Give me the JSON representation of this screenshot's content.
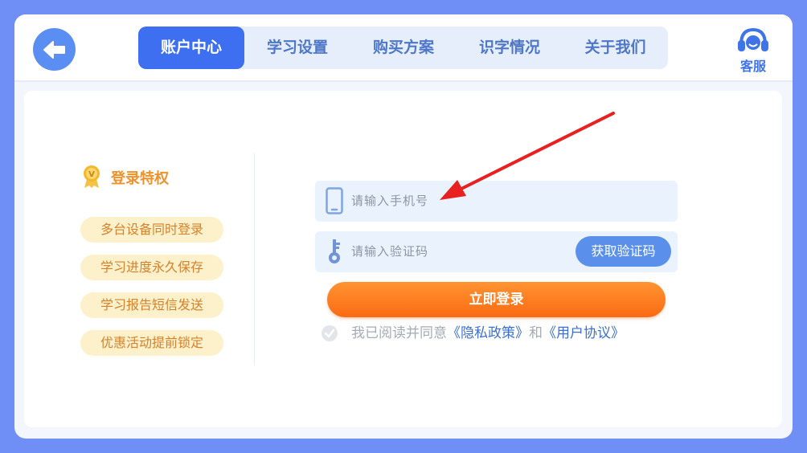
{
  "header": {
    "tabs": [
      {
        "label": "账户中心",
        "active": true
      },
      {
        "label": "学习设置",
        "active": false
      },
      {
        "label": "购买方案",
        "active": false
      },
      {
        "label": "识字情况",
        "active": false
      },
      {
        "label": "关于我们",
        "active": false
      }
    ],
    "service_label": "客服"
  },
  "privileges": {
    "title": "登录特权",
    "badge_letter": "V",
    "items": [
      "多台设备同时登录",
      "学习进度永久保存",
      "学习报告短信发送",
      "优惠活动提前锁定"
    ]
  },
  "form": {
    "phone_placeholder": "请输入手机号",
    "code_placeholder": "请输入验证码",
    "get_code_label": "获取验证码",
    "login_label": "立即登录",
    "agree_prefix": "我已阅读并同意",
    "privacy_link": "《隐私政策》",
    "agree_and": "和",
    "user_link": "《用户协议》"
  },
  "colors": {
    "background": "#6f8ff6",
    "accent_blue": "#3d6ff0",
    "orange": "#fc6a12",
    "annotation_arrow": "#e8201f"
  },
  "icons": [
    "back-arrow-icon",
    "headset-icon",
    "vip-badge-icon",
    "phone-icon",
    "key-icon",
    "check-icon"
  ]
}
